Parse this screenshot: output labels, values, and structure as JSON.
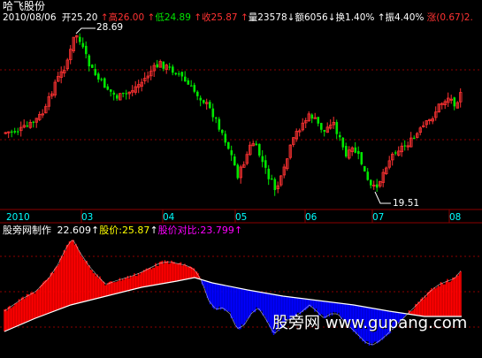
{
  "colors": {
    "background": "#000000",
    "up": "#ff3232",
    "down": "#00e600",
    "grid": "#8b0000",
    "fill_positive": "#ff0000",
    "fill_negative": "#0000ff",
    "yellow_text": "#ffff00",
    "magenta_text": "#ff00ff",
    "axis_text": "#00ffff"
  },
  "header": {
    "stock_name": "哈飞股份",
    "date": "2010/08/06",
    "open_label": "开",
    "open_value": "25.20",
    "high_label": "高",
    "high_value": "26.00",
    "low_label": "低",
    "low_value": "24.89",
    "close_label": "收",
    "close_value": "25.87",
    "volume_label": "量",
    "volume_value": "23578",
    "amount_label": "额",
    "amount_value": "6056",
    "turnover_label": "换",
    "turnover_value": "1.40%",
    "amplitude_label": "振",
    "amplitude_value": "4.40%",
    "change_label": "涨",
    "change_value": "(0.67)2."
  },
  "annotations": {
    "high_price": "28.69",
    "low_price": "19.51"
  },
  "time_axis": [
    "2010",
    "03",
    "04",
    "05",
    "06",
    "07",
    "08"
  ],
  "indicator": {
    "name": "股旁网制作",
    "value": "22.609",
    "price_label": "股价:",
    "price_value": "25.87",
    "ratio_label": "股价对比:",
    "ratio_value": "23.799"
  },
  "watermark": "股旁网 www.gupang.com",
  "chart_data": {
    "type": "candlestick",
    "time_labels": [
      "2010",
      "03",
      "04",
      "05",
      "06",
      "07",
      "08"
    ],
    "price_annotations": {
      "high": 28.69,
      "low": 19.51
    },
    "last_bar": {
      "open": 25.2,
      "high": 26.0,
      "low": 24.89,
      "close": 25.87,
      "volume": 23578
    }
  }
}
